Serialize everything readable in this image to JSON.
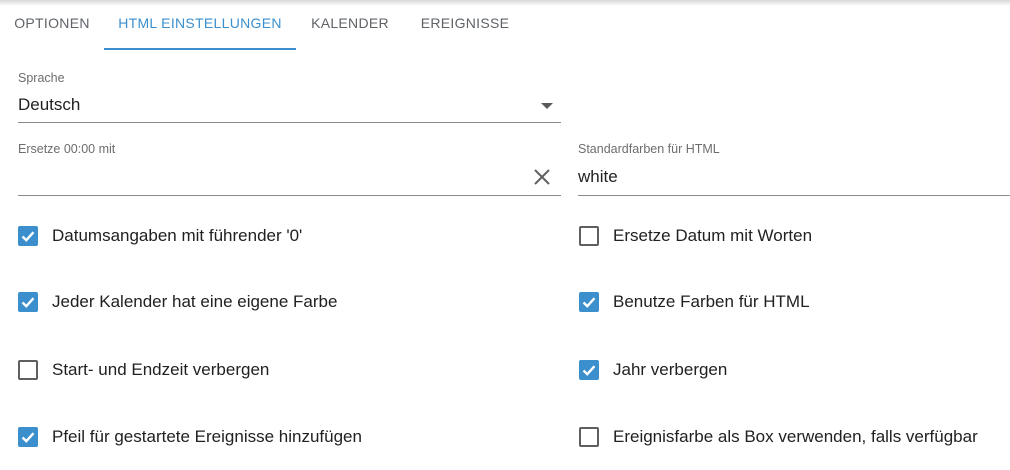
{
  "tabs": [
    {
      "label": "OPTIONEN",
      "active": false
    },
    {
      "label": "HTML EINSTELLUNGEN",
      "active": true
    },
    {
      "label": "KALENDER",
      "active": false
    },
    {
      "label": "EREIGNISSE",
      "active": false
    }
  ],
  "language": {
    "label": "Sprache",
    "value": "Deutsch"
  },
  "replace_midnight": {
    "label": "Ersetze 00:00 mit",
    "value": ""
  },
  "default_colors": {
    "label": "Standardfarben für HTML",
    "value": "white"
  },
  "checkboxes_left": [
    {
      "label": "Datumsangaben mit führender '0'",
      "checked": true
    },
    {
      "label": "Jeder Kalender hat eine eigene Farbe",
      "checked": true
    },
    {
      "label": "Start- und Endzeit verbergen",
      "checked": false
    },
    {
      "label": "Pfeil für gestartete Ereignisse hinzufügen",
      "checked": true
    }
  ],
  "checkboxes_right": [
    {
      "label": "Ersetze Datum mit Worten",
      "checked": false
    },
    {
      "label": "Benutze Farben für HTML",
      "checked": true
    },
    {
      "label": "Jahr verbergen",
      "checked": true
    },
    {
      "label": "Ereignisfarbe als Box verwenden, falls verfügbar",
      "checked": false
    }
  ],
  "colors": {
    "accent": "#3b8fcd",
    "checkbox_border": "#5f5f5f",
    "text": "#212121",
    "label": "#6d6d6d"
  },
  "icons": {
    "dropdown": "chevron-down-icon",
    "clear": "close-icon",
    "check": "check-icon"
  }
}
